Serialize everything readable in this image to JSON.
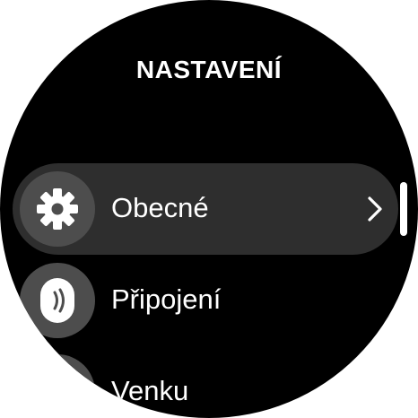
{
  "screen": {
    "title": "NASTAVENÍ"
  },
  "menu": {
    "items": [
      {
        "label": "Obecné",
        "icon": "gear-icon",
        "selected": true
      },
      {
        "label": "Připojení",
        "icon": "watch-connection-icon",
        "selected": false
      },
      {
        "label": "Venku",
        "icon": "outdoor-icon",
        "selected": false
      }
    ]
  },
  "colors": {
    "background": "#000000",
    "selected_row": "#2e2e2e",
    "icon_circle": "#4d4d4d",
    "text": "#ffffff"
  }
}
